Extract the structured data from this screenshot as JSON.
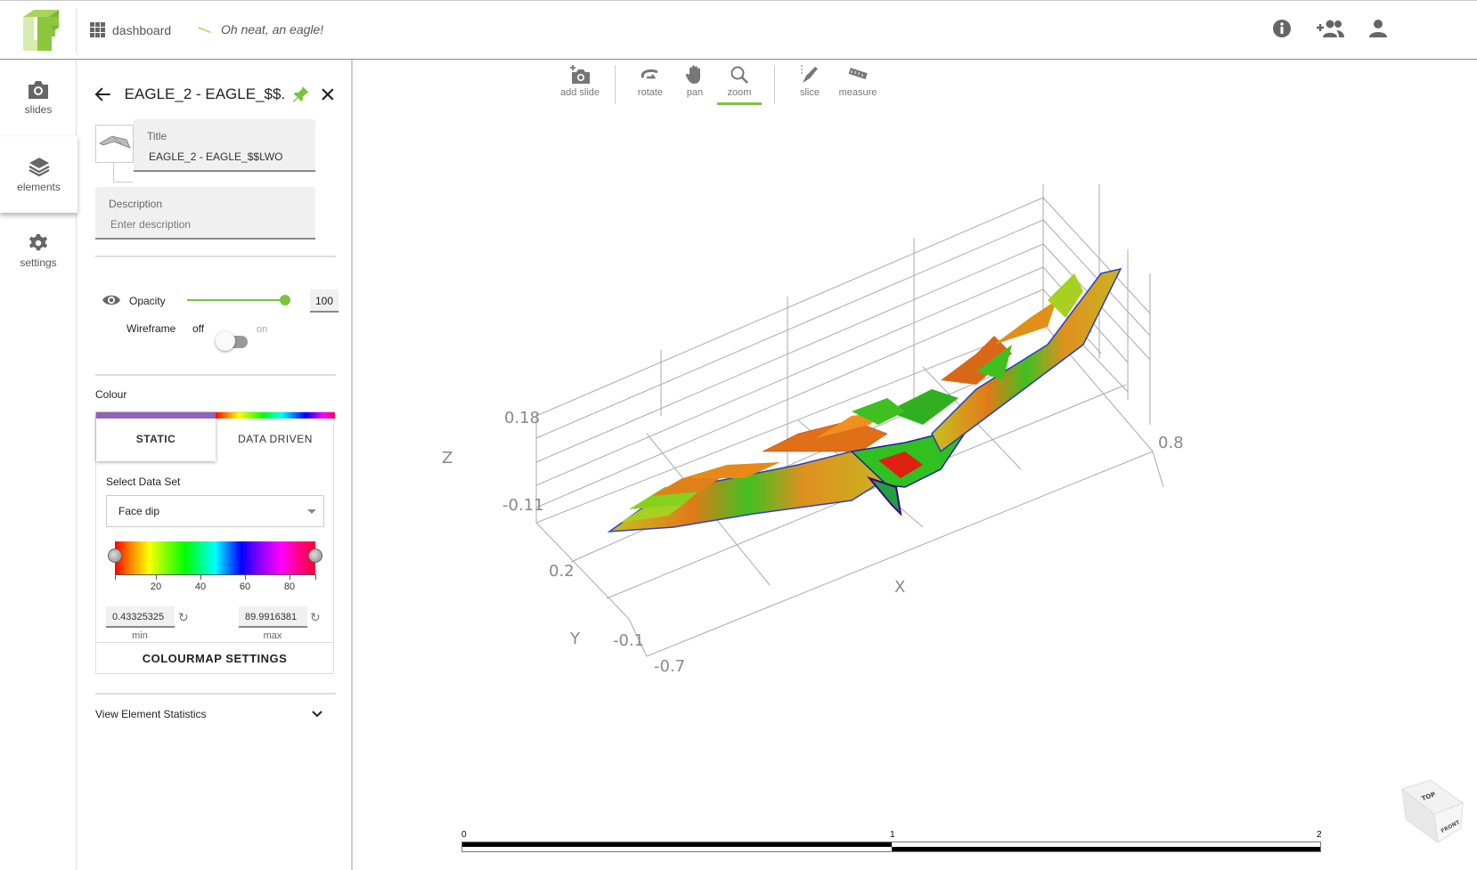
{
  "header": {
    "logo": "LF-logo",
    "dashboard_label": "dashboard",
    "project_name": "Oh neat, an eagle!",
    "icons": [
      "info-icon",
      "add-group-icon",
      "person-icon"
    ]
  },
  "navrail": {
    "items": [
      {
        "label": "slides",
        "icon": "camera-icon",
        "active": false
      },
      {
        "label": "elements",
        "icon": "layers-icon",
        "active": true
      },
      {
        "label": "settings",
        "icon": "gear-icon",
        "active": false
      }
    ]
  },
  "panel": {
    "header_title": "EAGLE_2 - EAGLE_$$...",
    "title_field": {
      "label": "Title",
      "value": "EAGLE_2 - EAGLE_$$LWO"
    },
    "description_field": {
      "label": "Description",
      "placeholder": "Enter description"
    },
    "opacity": {
      "label": "Opacity",
      "value": "100",
      "percent": 100
    },
    "wireframe": {
      "label": "Wireframe",
      "off_label": "off",
      "on_label": "on",
      "state": "off"
    },
    "colour": {
      "label": "Colour",
      "tabs": [
        {
          "label": "STATIC",
          "active": true
        },
        {
          "label": "DATA DRIVEN",
          "active": false
        }
      ],
      "select_label": "Select Data Set",
      "selected_dataset": "Face dip",
      "colormap_ticks": [
        "20",
        "40",
        "60",
        "80"
      ],
      "min_value": "0.43325325",
      "max_value": "89.9916381",
      "min_label": "min",
      "max_label": "max",
      "settings_button": "COLOURMAP SETTINGS"
    },
    "stats_label": "View Element Statistics"
  },
  "toolbar": {
    "tools": [
      {
        "label": "add slide",
        "icon": "add-camera-icon"
      },
      {
        "label": "rotate",
        "icon": "rotate-icon"
      },
      {
        "label": "pan",
        "icon": "hand-icon"
      },
      {
        "label": "zoom",
        "icon": "magnifier-icon",
        "active": true
      },
      {
        "label": "slice",
        "icon": "slice-icon"
      },
      {
        "label": "measure",
        "icon": "ruler-icon"
      }
    ]
  },
  "scene": {
    "axes": {
      "z_label": "Z",
      "z_ticks": [
        "0.18",
        "-0.11"
      ],
      "y_label": "Y",
      "y_ticks": [
        "0.2",
        "-0.1"
      ],
      "x_label": "X",
      "x_ticks": [
        "-0.7",
        "0.8"
      ]
    },
    "scalebar": {
      "labels": [
        "0",
        "1",
        "2"
      ]
    },
    "navcube": {
      "top": "TOP",
      "front": "FRONT"
    }
  }
}
